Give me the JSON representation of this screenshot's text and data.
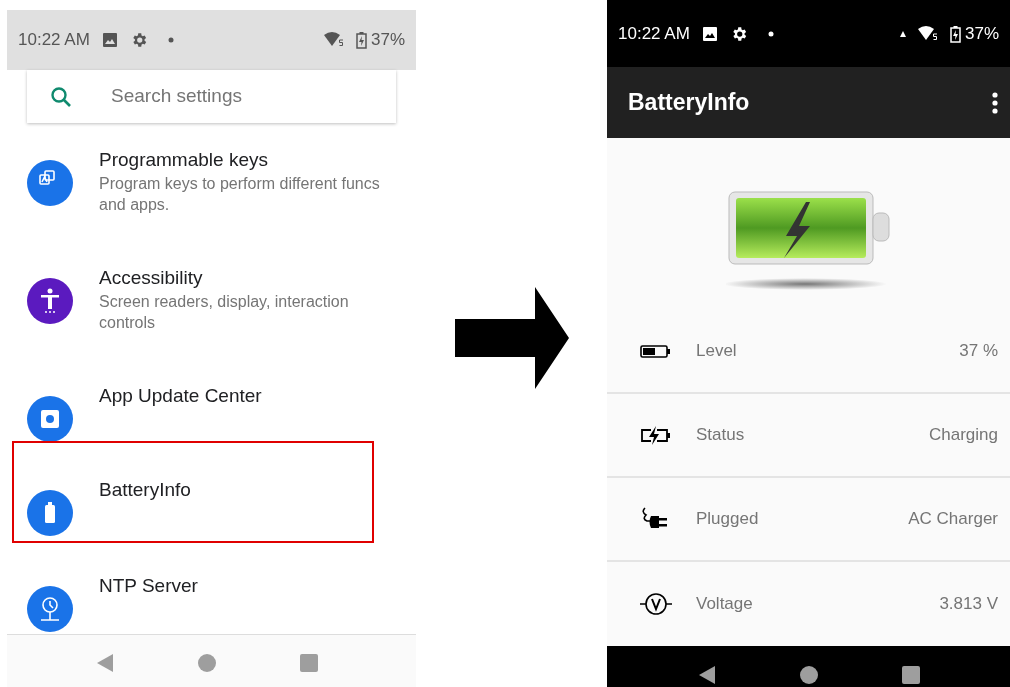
{
  "settings_screen": {
    "status_bar": {
      "time": "10:22 AM",
      "battery": "37%"
    },
    "search": {
      "placeholder": "Search settings"
    },
    "items": [
      {
        "kind": "keys",
        "title": "Programmable keys",
        "subtitle": "Program keys to perform different funcs and apps.",
        "selected": false
      },
      {
        "kind": "accessibility",
        "title": "Accessibility",
        "subtitle": "Screen readers, display, interaction controls",
        "selected": false
      },
      {
        "kind": "app-update",
        "title": "App Update Center",
        "selected": false
      },
      {
        "kind": "battery",
        "title": "BatteryInfo",
        "selected": true
      },
      {
        "kind": "ntp",
        "title": "NTP Server",
        "selected": false
      }
    ]
  },
  "battery_screen": {
    "status_bar": {
      "time": "10:22 AM",
      "battery": "37%"
    },
    "app_bar": {
      "title": "BatteryInfo"
    },
    "rows": [
      {
        "kind": "level",
        "label": "Level",
        "value": "37 %"
      },
      {
        "kind": "status",
        "label": "Status",
        "value": "Charging"
      },
      {
        "kind": "plug",
        "label": "Plugged",
        "value": "AC Charger"
      },
      {
        "kind": "voltage",
        "label": "Voltage",
        "value": "3.813 V"
      }
    ]
  }
}
